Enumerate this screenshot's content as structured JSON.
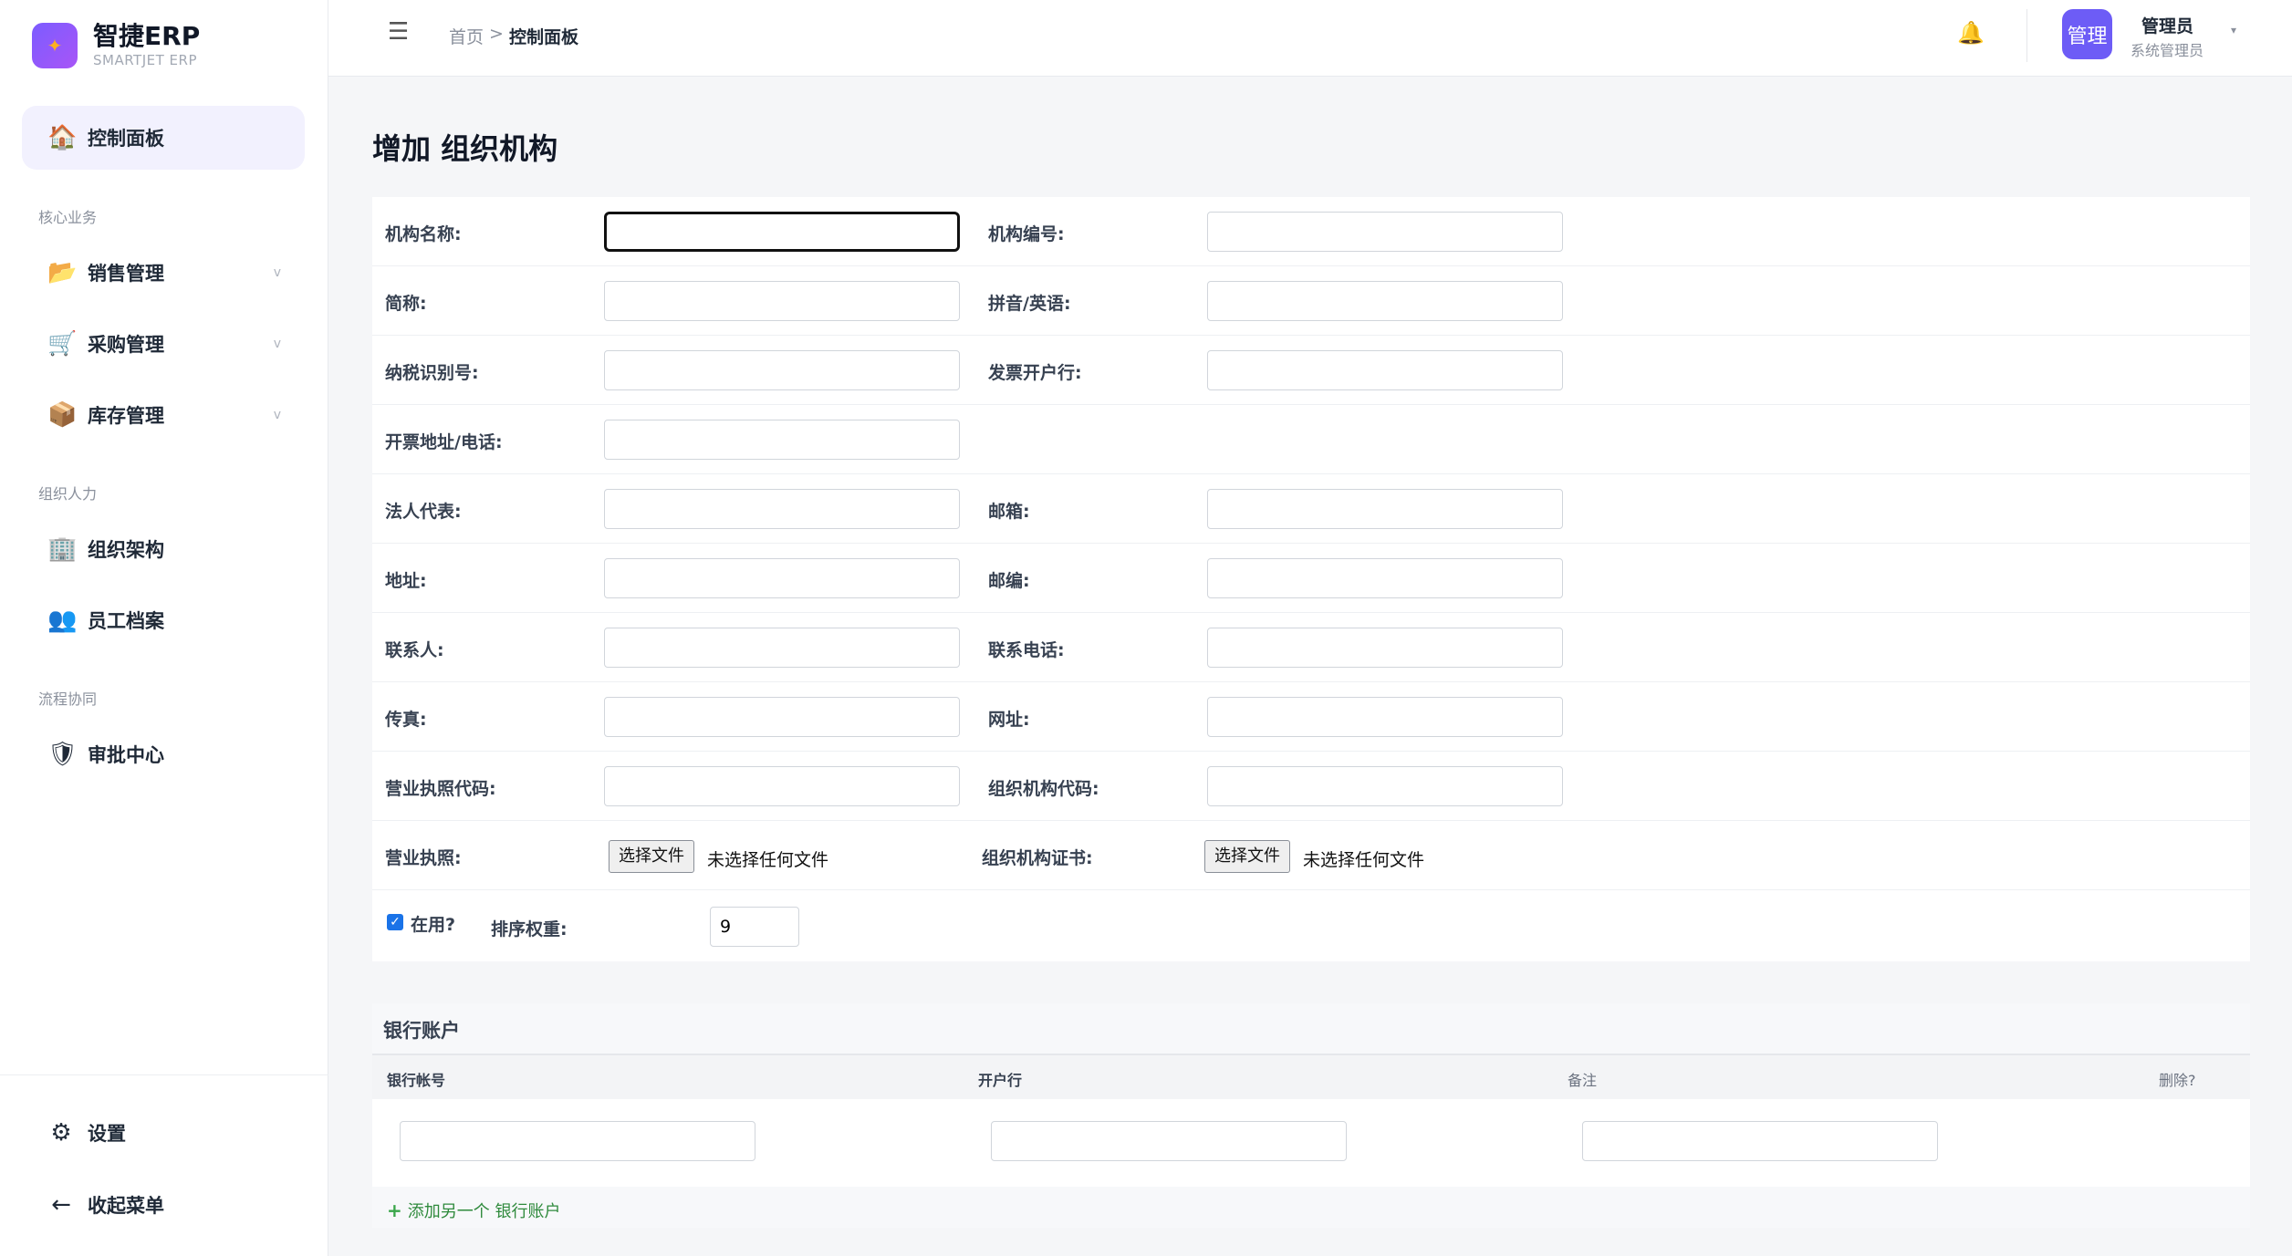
{
  "app": {
    "title": "智捷ERP",
    "subtitle": "SMARTJET ERP"
  },
  "sidebar": {
    "dashboard": "控制面板",
    "section_core": "核心业务",
    "sales": "销售管理",
    "purchase": "采购管理",
    "inventory": "库存管理",
    "section_org": "组织人力",
    "org_structure": "组织架构",
    "employees": "员工档案",
    "section_flow": "流程协同",
    "approval": "审批中心",
    "settings": "设置",
    "collapse": "收起菜单",
    "chevron": "v"
  },
  "header": {
    "breadcrumb_home": "首页",
    "breadcrumb_sep": ">",
    "breadcrumb_current": "控制面板",
    "avatar_text": "管理",
    "user_name": "管理员",
    "user_role": "系统管理员"
  },
  "page": {
    "title": "增加 组织机构"
  },
  "form": {
    "name_label": "机构名称:",
    "code_label": "机构编号:",
    "short_label": "简称:",
    "pinyin_label": "拼音/英语:",
    "tax_label": "纳税识别号:",
    "bank_label": "发票开户行:",
    "invoice_addr_label": "开票地址/电话:",
    "legal_label": "法人代表:",
    "email_label": "邮箱:",
    "address_label": "地址:",
    "zip_label": "邮编:",
    "contact_label": "联系人:",
    "phone_label": "联系电话:",
    "fax_label": "传真:",
    "website_label": "网址:",
    "license_code_label": "营业执照代码:",
    "org_code_label": "组织机构代码:",
    "license_label": "营业执照:",
    "org_cert_label": "组织机构证书:",
    "choose_file": "选择文件",
    "no_file": "未选择任何文件",
    "active_label": "在用?",
    "active_checked": true,
    "sort_label": "排序权重:",
    "sort_value": "9"
  },
  "bank": {
    "title": "银行账户",
    "col_account": "银行帐号",
    "col_bank": "开户行",
    "col_note": "备注",
    "col_delete": "删除?",
    "add_link": "添加另一个 银行账户"
  }
}
